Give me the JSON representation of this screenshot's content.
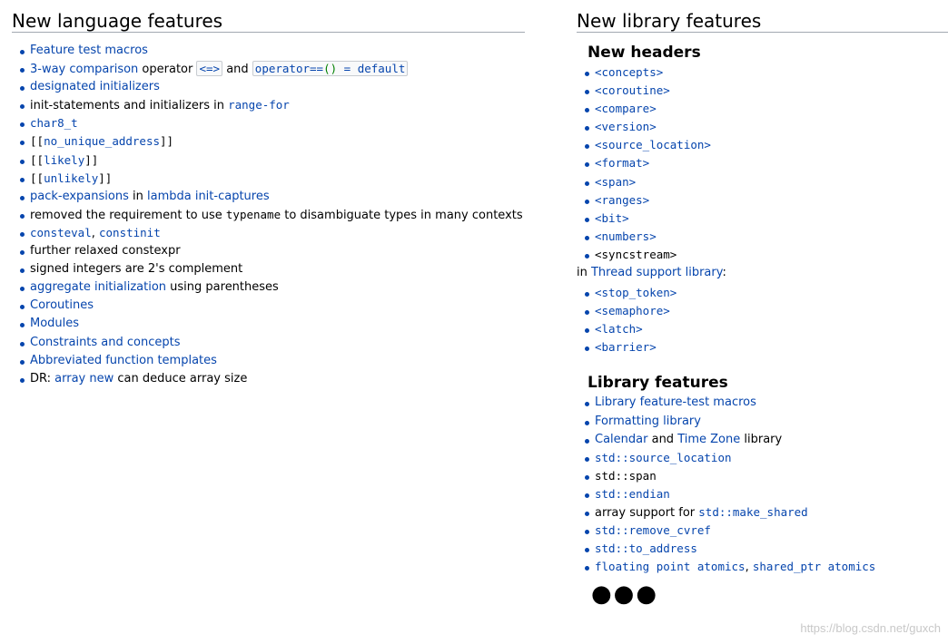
{
  "lang": {
    "title": "New language features",
    "items": {
      "feature_test_macros": "Feature test macros",
      "three_way_link": "3-way comparison",
      "three_way_operator": " operator ",
      "spaceship": "<=>",
      "and": " and ",
      "opeq_name": "operator==",
      "opeq_parens": "()",
      "opeq_tail": " = default",
      "designated": "designated initializers",
      "init_statements": "init-statements and initializers in ",
      "range_for": "range-for",
      "char8_t": "char8_t",
      "bracket_open": "[[",
      "bracket_close": "]]",
      "no_unique_address": "no_unique_address",
      "likely": "likely",
      "unlikely": "unlikely",
      "pack_expansions": "pack-expansions",
      "in": " in ",
      "lambda_init_captures": "lambda init-captures",
      "removed_req_pre": "removed the requirement to use ",
      "typename": "typename",
      "removed_req_post": " to disambiguate types in many contexts",
      "consteval": "consteval",
      "comma": ", ",
      "constinit": "constinit",
      "relaxed_constexpr": "further relaxed constexpr",
      "signed_integers": "signed integers are 2's complement",
      "aggregate_init": "aggregate initialization",
      "using_parens": " using parentheses",
      "coroutines": "Coroutines",
      "modules": "Modules",
      "constraints": "Constraints and concepts",
      "abbreviated": "Abbreviated function templates",
      "dr_prefix": "DR: ",
      "array_new": "array new",
      "dr_suffix": " can deduce array size"
    }
  },
  "lib": {
    "title": "New library features",
    "headers_title": "New headers",
    "headers": [
      "<concepts>",
      "<coroutine>",
      "<compare>",
      "<version>",
      "<source_location>",
      "<format>",
      "<span>",
      "<ranges>",
      "<bit>",
      "<numbers>",
      "<syncstream>"
    ],
    "thread_prefix": "in ",
    "thread_link": "Thread support library",
    "thread_suffix": ":",
    "thread_headers": [
      "<stop_token>",
      "<semaphore>",
      "<latch>",
      "<barrier>"
    ],
    "features_title": "Library features",
    "features": {
      "feature_test_macros": "Library feature-test macros",
      "formatting": "Formatting library",
      "calendar": "Calendar",
      "and": " and ",
      "time_zone": "Time Zone",
      "library": " library",
      "source_location": "std::source_location",
      "span": "std::span",
      "endian": "std::endian",
      "array_support": "array support for ",
      "make_shared": "std::make_shared",
      "remove_cvref": "std::remove_cvref",
      "to_address": "std::to_address",
      "floating_point_atomics": "floating point atomics",
      "comma": ", ",
      "shared_ptr_atomics": "shared_ptr atomics"
    },
    "ellipsis": "●●●"
  },
  "watermark": "https://blog.csdn.net/guxch"
}
